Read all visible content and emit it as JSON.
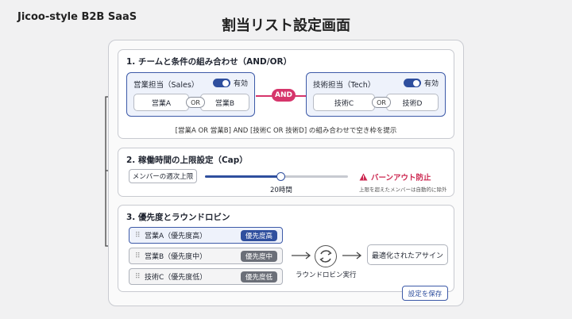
{
  "brand": "Jicoo-style B2B SaaS",
  "page_title": "割当リスト設定画面",
  "section1": {
    "title": "1. チームと条件の組み合わせ（AND/OR）",
    "group_a": {
      "label": "営業担当（Sales）",
      "toggle_label": "有効",
      "enabled": true,
      "member1": "営業A",
      "or": "OR",
      "member2": "営業B"
    },
    "group_b": {
      "label": "技術担当（Tech）",
      "toggle_label": "有効",
      "enabled": true,
      "member1": "技術C",
      "or": "OR",
      "member2": "技術D"
    },
    "and_label": "AND",
    "summary": "[営業A OR 営業B] AND [技術C OR 技術D] の組み合わせで空き枠を提示"
  },
  "section2": {
    "title": "2. 稼働時間の上限設定（Cap）",
    "cap_label": "メンバーの週次上限",
    "slider_fraction": 0.53,
    "slider_value": "20時間",
    "warning_title": "バーンアウト防止",
    "warning_sub": "上限を超えたメンバーは自動的に除外"
  },
  "section3": {
    "title": "3. 優先度とラウンドロビン",
    "items": [
      {
        "label": "営業A（優先度高）",
        "badge": "優先度高",
        "badge_color": "#2f4f9e"
      },
      {
        "label": "営業B（優先度中）",
        "badge": "優先度中",
        "badge_color": "#6b6f78"
      },
      {
        "label": "技術C（優先度低）",
        "badge": "優先度低",
        "badge_color": "#6b6f78"
      }
    ],
    "round_robin_label": "ラウンドロビン実行",
    "result_label": "最適化されたアサイン",
    "save_label": "設定を保存"
  },
  "colors": {
    "accent": "#2f4f9e",
    "and": "#d6356b",
    "warning": "#cc2750"
  },
  "icons": {
    "warning": "warning-triangle-icon",
    "round_robin": "refresh-cycle-icon",
    "grip": "drag-handle-icon"
  }
}
